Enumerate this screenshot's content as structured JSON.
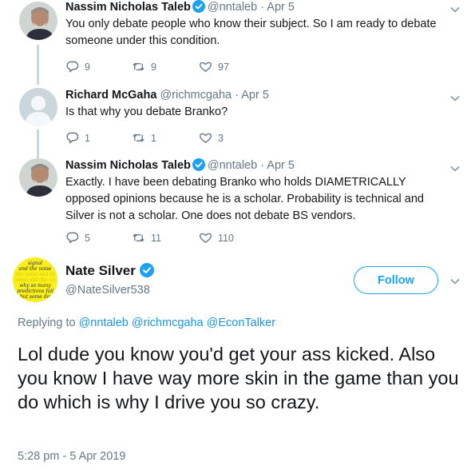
{
  "tweets": [
    {
      "name": "Nassim Nicholas Taleb",
      "handle": "@nntaleb",
      "separator": "·",
      "date": "Apr 5",
      "text": "You only debate people who know their subject. So I am ready to debate someone under this condition.",
      "replies": "9",
      "retweets": "9",
      "likes": "97",
      "verified": true
    },
    {
      "name": "Richard McGaha",
      "handle": "@richmcgaha",
      "separator": "·",
      "date": "Apr 5",
      "text": "Is that why you debate Branko?",
      "replies": "1",
      "retweets": "1",
      "likes": "3",
      "verified": false
    },
    {
      "name": "Nassim Nicholas Taleb",
      "handle": "@nntaleb",
      "separator": "·",
      "date": "Apr 5",
      "text": "Exactly. I have been debating Branko who holds DIAMETRICALLY opposed opinions because he is a scholar. Probability is technical and Silver is not a scholar. One does not debate BS vendors.",
      "replies": "5",
      "retweets": "11",
      "likes": "110",
      "verified": true
    }
  ],
  "main_tweet": {
    "name": "Nate Silver",
    "handle": "@NateSilver538",
    "follow_label": "Follow",
    "avatar_text": [
      "signal",
      "and the noise",
      "the noise and th",
      "noise and the no",
      "why so many",
      "predictions fail",
      "– but some don’"
    ],
    "replying_prefix": "Replying to",
    "replying_handles": [
      "@nntaleb",
      "@richmcgaha",
      "@EconTalker"
    ],
    "text": "Lol dude you know you'd get your ass kicked. Also you know I have way more skin in the game than you do which is why I drive you so crazy.",
    "timestamp": "5:28 pm - 5 Apr 2019"
  },
  "colors": {
    "accent": "#1da1f2",
    "link": "#1b95e0",
    "muted": "#657786",
    "thread_line": "#ccd6dd",
    "nate_avatar_bg": "#f8ef1d"
  },
  "icons": {
    "reply": "reply-icon",
    "retweet": "retweet-icon",
    "like": "heart-icon",
    "verified": "verified-badge-icon",
    "menu": "chevron-down-icon"
  }
}
